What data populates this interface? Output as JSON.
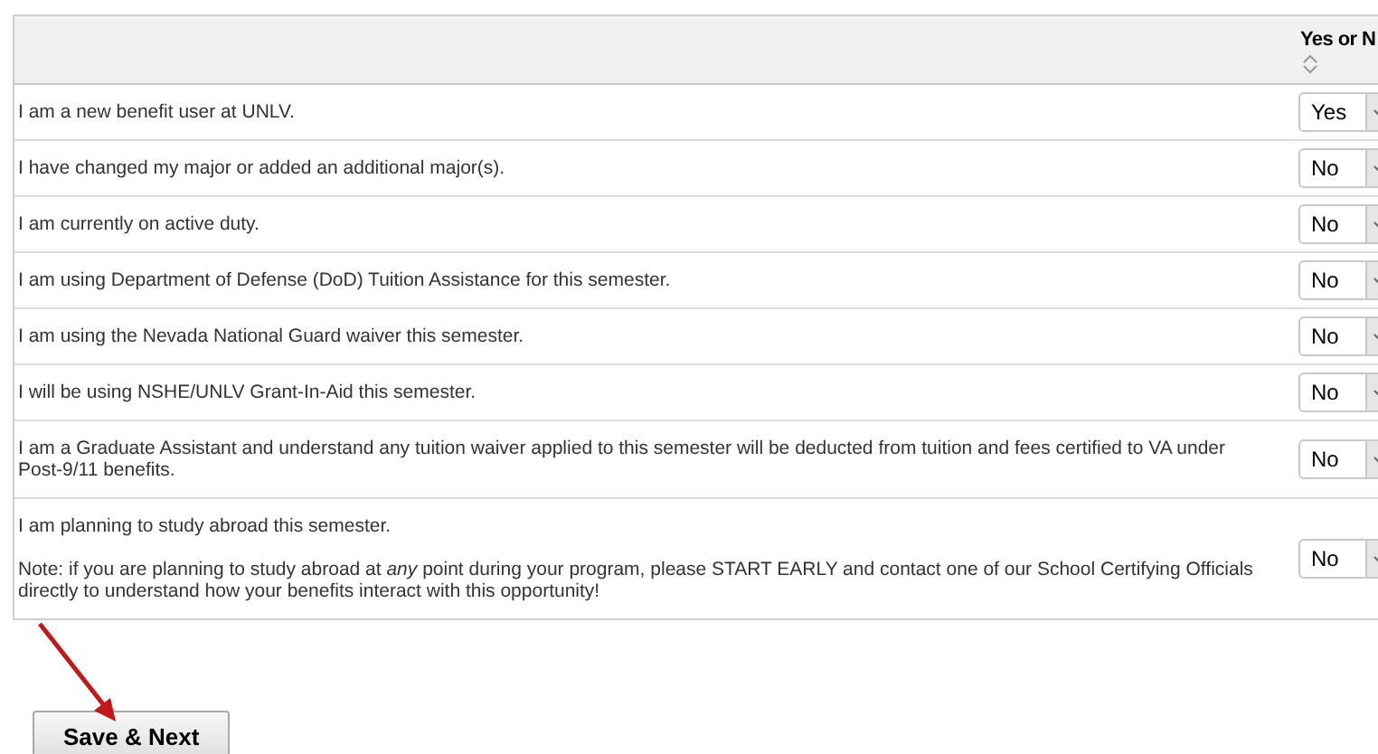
{
  "table": {
    "columns": [
      {
        "label": "Yes or N",
        "sortable": true
      }
    ],
    "rows": [
      {
        "question": "I am a new benefit user at UNLV.",
        "answer": "Yes"
      },
      {
        "question": "I have changed my major or added an additional major(s).",
        "answer": "No"
      },
      {
        "question": "I am currently on active duty.",
        "answer": "No"
      },
      {
        "question": "I am using Department of Defense (DoD) Tuition Assistance for this semester.",
        "answer": "No"
      },
      {
        "question": "I am using the Nevada National Guard waiver this semester.",
        "answer": "No"
      },
      {
        "question": "I will be using NSHE/UNLV Grant-In-Aid this semester.",
        "answer": "No"
      },
      {
        "question": "I am a Graduate Assistant and understand any tuition waiver applied to this semester will be deducted from tuition and fees certified to VA under Post-9/11 benefits.",
        "answer": "No"
      },
      {
        "question": "I am planning to study abroad this semester.",
        "note": "Note: if you are planning to study abroad at *any* point during your program, please START EARLY and contact one of our School Certifying Officials directly to understand how your benefits interact with this opportunity!",
        "answer": "No"
      }
    ]
  },
  "save_button": "Save & Next"
}
